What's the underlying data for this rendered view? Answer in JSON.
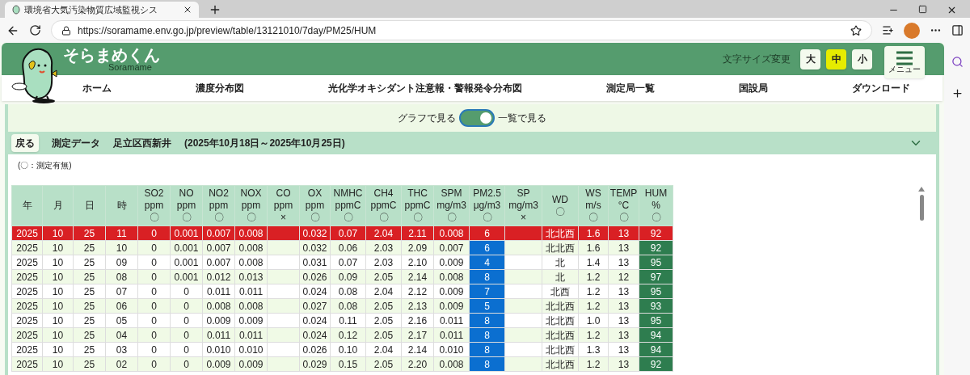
{
  "browser": {
    "tab_title": "環境省大気汚染物質広域監視シス",
    "url": "https://soramame.env.go.jp/preview/table/13121010/7day/PM25/HUM"
  },
  "header": {
    "logo": "そらまめくん",
    "logo_sub": "Soramame",
    "font_size_label": "文字サイズ変更",
    "font_sizes": [
      {
        "label": "大",
        "selected": false
      },
      {
        "label": "中",
        "selected": true
      },
      {
        "label": "小",
        "selected": false
      }
    ],
    "menu_label": "メニュー"
  },
  "nav": [
    "ホーム",
    "濃度分布図",
    "光化学オキシダント注意報・警報発令分布図",
    "測定局一覧",
    "国設局",
    "ダウンロード"
  ],
  "view_toggle": {
    "left": "グラフで見る",
    "right": "一覧で見る",
    "on": true
  },
  "panel": {
    "back": "戻る",
    "title": "測定データ",
    "station": "足立区西新井",
    "period": "(2025年10月18日～2025年10月25日)",
    "note": "(〇：測定有無)"
  },
  "table": {
    "columns": [
      {
        "label": "年",
        "highlighted": false
      },
      {
        "label": "月",
        "highlighted": false
      },
      {
        "label": "日",
        "highlighted": false
      },
      {
        "label": "時",
        "highlighted": false
      },
      {
        "label": "SO2",
        "unit": "ppm",
        "mark": "〇",
        "highlighted": false
      },
      {
        "label": "NO",
        "unit": "ppm",
        "mark": "〇",
        "highlighted": false
      },
      {
        "label": "NO2",
        "unit": "ppm",
        "mark": "〇",
        "highlighted": false
      },
      {
        "label": "NOX",
        "unit": "ppm",
        "mark": "〇",
        "highlighted": false
      },
      {
        "label": "CO",
        "unit": "ppm",
        "mark": "×",
        "highlighted": false
      },
      {
        "label": "OX",
        "unit": "ppm",
        "mark": "〇",
        "highlighted": false
      },
      {
        "label": "NMHC",
        "unit": "ppmC",
        "mark": "〇",
        "highlighted": false
      },
      {
        "label": "CH4",
        "unit": "ppmC",
        "mark": "〇",
        "highlighted": false
      },
      {
        "label": "THC",
        "unit": "ppmC",
        "mark": "〇",
        "highlighted": false
      },
      {
        "label": "SPM",
        "unit": "mg/m3",
        "mark": "〇",
        "highlighted": false
      },
      {
        "label": "PM2.5",
        "unit": "μg/m3",
        "mark": "〇",
        "highlighted": true,
        "color": "#0b6fd0"
      },
      {
        "label": "SP",
        "unit": "mg/m3",
        "mark": "×",
        "highlighted": false
      },
      {
        "label": "WD",
        "mark": "〇",
        "highlighted": false
      },
      {
        "label": "WS",
        "unit": "m/s",
        "mark": "〇",
        "highlighted": false
      },
      {
        "label": "TEMP",
        "unit": "°C",
        "mark": "〇",
        "highlighted": false
      },
      {
        "label": "HUM",
        "unit": "%",
        "mark": "〇",
        "highlighted": true,
        "color": "#2e7d4f"
      }
    ],
    "rows": [
      {
        "selected": true,
        "cells": [
          "2025",
          "10",
          "25",
          "11",
          "0",
          "0.001",
          "0.007",
          "0.008",
          null,
          "0.032",
          "0.07",
          "2.04",
          "2.11",
          "0.008",
          "6",
          null,
          "北北西",
          "1.6",
          "13",
          "92"
        ]
      },
      {
        "selected": false,
        "cells": [
          "2025",
          "10",
          "25",
          "10",
          "0",
          "0.001",
          "0.007",
          "0.008",
          null,
          "0.032",
          "0.06",
          "2.03",
          "2.09",
          "0.007",
          "6",
          null,
          "北北西",
          "1.6",
          "13",
          "92"
        ]
      },
      {
        "selected": false,
        "cells": [
          "2025",
          "10",
          "25",
          "09",
          "0",
          "0.001",
          "0.007",
          "0.008",
          null,
          "0.031",
          "0.07",
          "2.03",
          "2.10",
          "0.009",
          "4",
          null,
          "北",
          "1.4",
          "13",
          "95"
        ]
      },
      {
        "selected": false,
        "cells": [
          "2025",
          "10",
          "25",
          "08",
          "0",
          "0.001",
          "0.012",
          "0.013",
          null,
          "0.026",
          "0.09",
          "2.05",
          "2.14",
          "0.008",
          "8",
          null,
          "北",
          "1.2",
          "12",
          "97"
        ]
      },
      {
        "selected": false,
        "cells": [
          "2025",
          "10",
          "25",
          "07",
          "0",
          "0",
          "0.011",
          "0.011",
          null,
          "0.024",
          "0.08",
          "2.04",
          "2.12",
          "0.009",
          "7",
          null,
          "北西",
          "1.2",
          "13",
          "95"
        ]
      },
      {
        "selected": false,
        "cells": [
          "2025",
          "10",
          "25",
          "06",
          "0",
          "0",
          "0.008",
          "0.008",
          null,
          "0.027",
          "0.08",
          "2.05",
          "2.13",
          "0.009",
          "5",
          null,
          "北北西",
          "1.2",
          "13",
          "93"
        ]
      },
      {
        "selected": false,
        "cells": [
          "2025",
          "10",
          "25",
          "05",
          "0",
          "0",
          "0.009",
          "0.009",
          null,
          "0.024",
          "0.11",
          "2.05",
          "2.16",
          "0.011",
          "8",
          null,
          "北北西",
          "1.0",
          "13",
          "95"
        ]
      },
      {
        "selected": false,
        "cells": [
          "2025",
          "10",
          "25",
          "04",
          "0",
          "0",
          "0.011",
          "0.011",
          null,
          "0.024",
          "0.12",
          "2.05",
          "2.17",
          "0.011",
          "8",
          null,
          "北北西",
          "1.2",
          "13",
          "94"
        ]
      },
      {
        "selected": false,
        "cells": [
          "2025",
          "10",
          "25",
          "03",
          "0",
          "0",
          "0.010",
          "0.010",
          null,
          "0.026",
          "0.10",
          "2.04",
          "2.14",
          "0.010",
          "8",
          null,
          "北北西",
          "1.3",
          "13",
          "94"
        ]
      },
      {
        "selected": false,
        "cells": [
          "2025",
          "10",
          "25",
          "02",
          "0",
          "0",
          "0.009",
          "0.009",
          null,
          "0.029",
          "0.15",
          "2.05",
          "2.20",
          "0.008",
          "8",
          null,
          "北北西",
          "1.2",
          "13",
          "92"
        ]
      }
    ]
  }
}
